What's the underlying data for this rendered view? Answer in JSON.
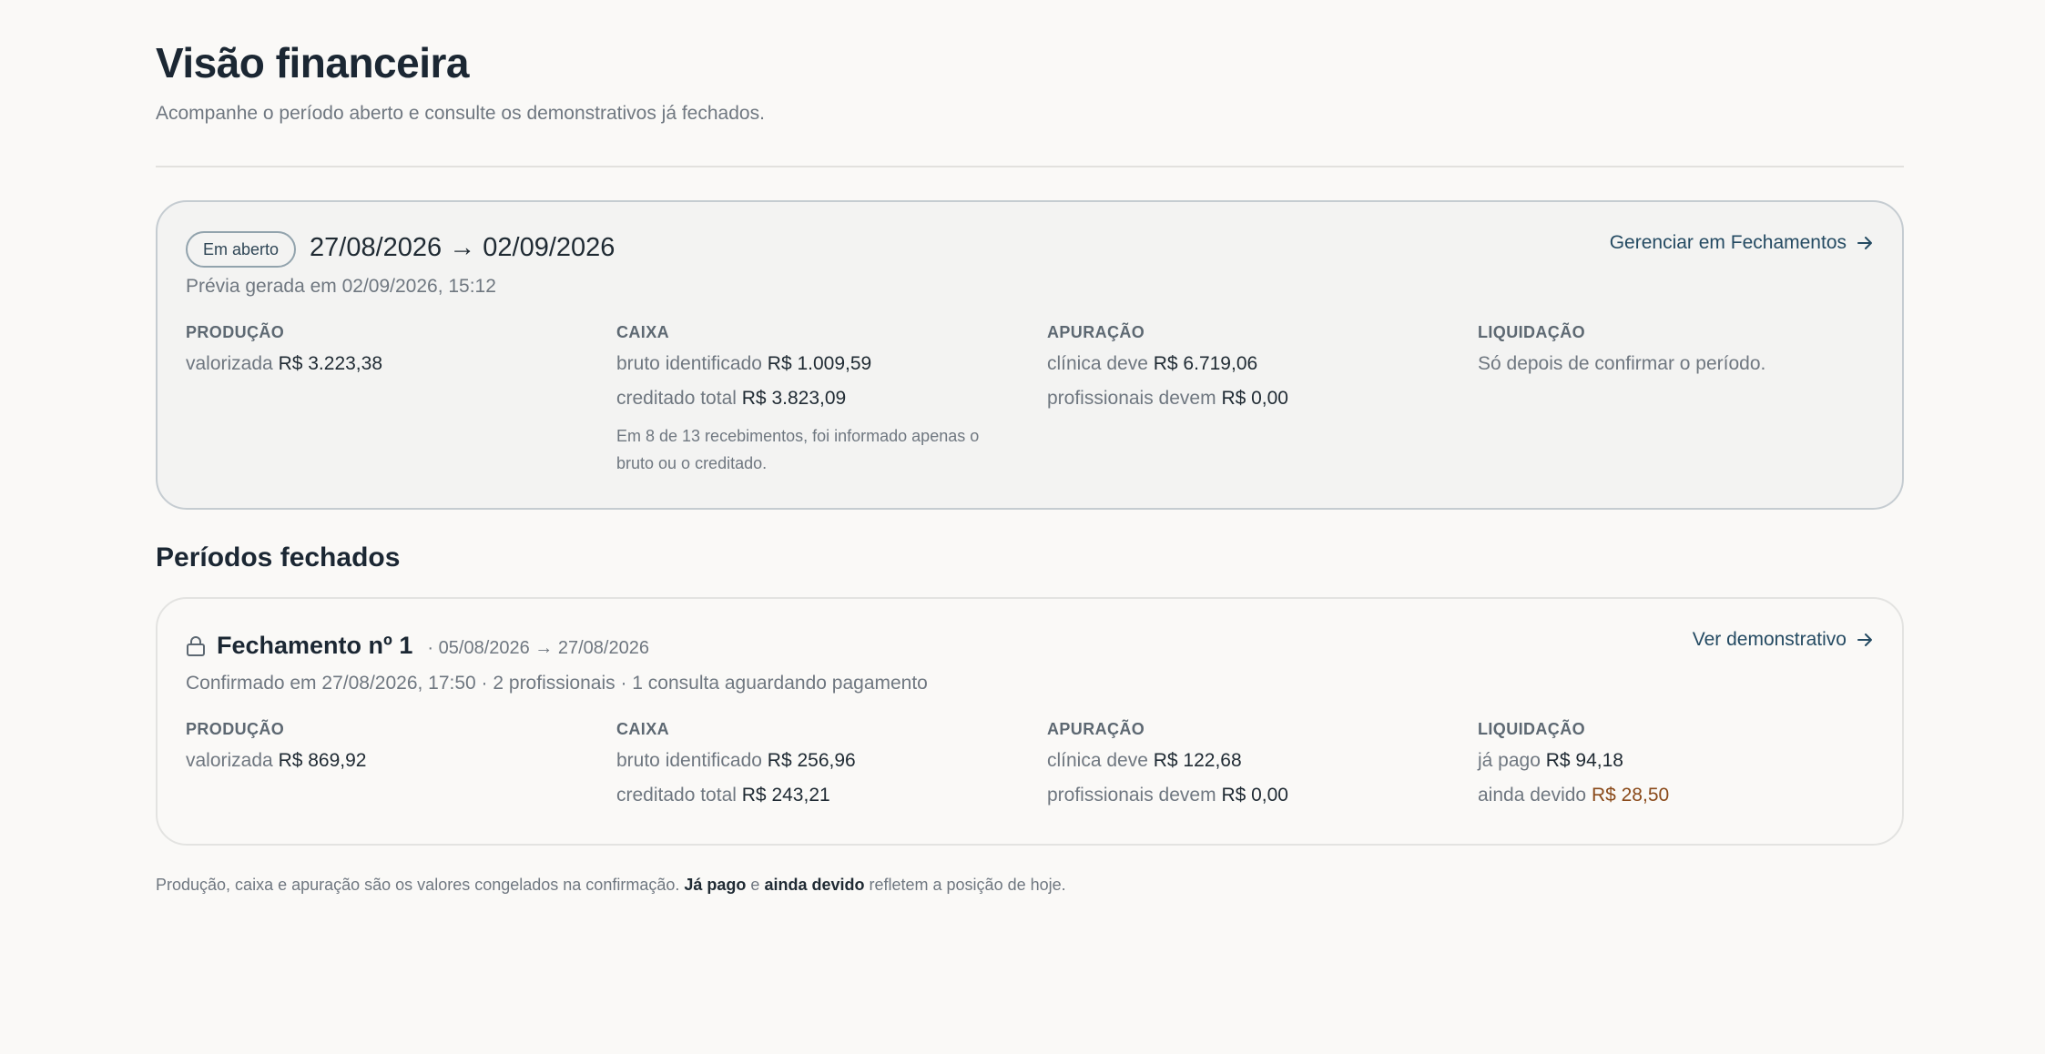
{
  "header": {
    "title": "Visão financeira",
    "subtitle": "Acompanhe o período aberto e consulte os demonstrativos já fechados."
  },
  "open_period": {
    "badge": "Em aberto",
    "range": "27/08/2026 → 02/09/2026",
    "preview_note": "Prévia gerada em 02/09/2026, 15:12",
    "action_label": "Gerenciar em Fechamentos",
    "producao": {
      "heading": "PRODUÇÃO",
      "valorizada_label": "valorizada",
      "valorizada_value": "R$ 3.223,38"
    },
    "caixa": {
      "heading": "CAIXA",
      "bruto_label": "bruto identificado",
      "bruto_value": "R$ 1.009,59",
      "creditado_label": "creditado total",
      "creditado_value": "R$ 3.823,09",
      "note": "Em 8 de 13 recebimentos, foi informado apenas o bruto ou o creditado."
    },
    "apuracao": {
      "heading": "APURAÇÃO",
      "clinica_label": "clínica deve",
      "clinica_value": "R$ 6.719,06",
      "prof_label": "profissionais devem",
      "prof_value": "R$ 0,00"
    },
    "liquidacao": {
      "heading": "LIQUIDAÇÃO",
      "text": "Só depois de confirmar o período."
    }
  },
  "closed_section": {
    "title": "Períodos fechados",
    "items": [
      {
        "title": "Fechamento nº 1",
        "dates": "· 05/08/2026 → 27/08/2026",
        "confirmed": "Confirmado em 27/08/2026, 17:50 · 2 profissionais · 1 consulta aguardando pagamento",
        "action_label": "Ver demonstrativo",
        "producao": {
          "heading": "PRODUÇÃO",
          "valorizada_label": "valorizada",
          "valorizada_value": "R$ 869,92"
        },
        "caixa": {
          "heading": "CAIXA",
          "bruto_label": "bruto identificado",
          "bruto_value": "R$ 256,96",
          "creditado_label": "creditado total",
          "creditado_value": "R$ 243,21"
        },
        "apuracao": {
          "heading": "APURAÇÃO",
          "clinica_label": "clínica deve",
          "clinica_value": "R$ 122,68",
          "prof_label": "profissionais devem",
          "prof_value": "R$ 0,00"
        },
        "liquidacao": {
          "heading": "LIQUIDAÇÃO",
          "pago_label": "já pago",
          "pago_value": "R$ 94,18",
          "devido_label": "ainda devido",
          "devido_value": "R$ 28,50"
        }
      }
    ]
  },
  "footnote": {
    "part1": "Produção, caixa e apuração são os valores congelados na confirmação.",
    "bold1": "Já pago",
    "part2": "e",
    "bold2": "ainda devido",
    "part3": "refletem a posição de hoje."
  },
  "colors": {
    "accent": "#244a62",
    "owed": "#8a4a1a",
    "background": "#faf9f7"
  },
  "icons": {
    "action_arrow": "arrow-right-icon",
    "closed_lock": "lock-icon"
  }
}
